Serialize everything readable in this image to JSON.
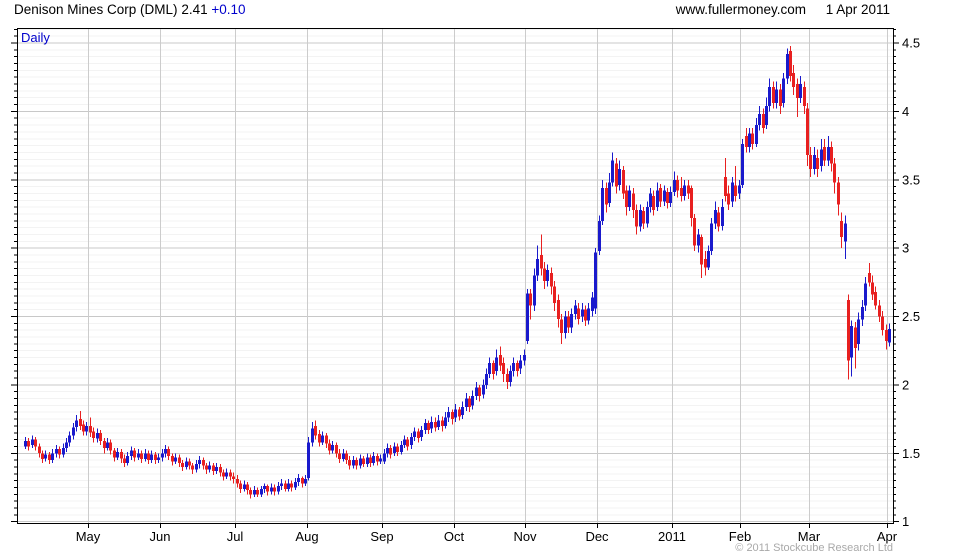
{
  "header": {
    "instrument": "Denison Mines Corp (DML)",
    "price": "2.41",
    "change": "+0.10",
    "website": "www.fullermoney.com",
    "date": "1 Apr 2011"
  },
  "chart": {
    "frequency_label": "Daily",
    "copyright": "© 2011 Stockcube Research Ltd"
  },
  "colors": {
    "up": "#1a1acc",
    "down": "#e82020",
    "grid_major": "#c8c8c8",
    "grid_minor": "#f3f3f3",
    "month_line": "#cccccc",
    "border": "#000000",
    "accent_blue": "#0000cc",
    "copyright_grey": "#a9a9a9"
  },
  "chart_data": {
    "type": "candlestick",
    "title": "Denison Mines Corp (DML)",
    "frequency": "Daily",
    "last_price": 2.41,
    "change": 0.1,
    "ylim": [
      0.99,
      4.61
    ],
    "y_ticks": [
      1,
      1.5,
      2,
      2.5,
      3,
      3.5,
      4,
      4.5
    ],
    "y_minor_step": 0.05,
    "x_months": [
      {
        "label": "May",
        "start": 19
      },
      {
        "label": "Jun",
        "start": 40
      },
      {
        "label": "Jul",
        "start": 62
      },
      {
        "label": "Aug",
        "start": 83
      },
      {
        "label": "Sep",
        "start": 105
      },
      {
        "label": "Oct",
        "start": 126
      },
      {
        "label": "Nov",
        "start": 147
      },
      {
        "label": "Dec",
        "start": 168
      },
      {
        "label": "2011",
        "start": 190
      },
      {
        "label": "Feb",
        "start": 210
      },
      {
        "label": "Mar",
        "start": 230
      },
      {
        "label": "Apr",
        "start": 253
      }
    ],
    "ohlc_format": [
      "open",
      "high",
      "low",
      "close"
    ],
    "ohlc": [
      [
        1.55,
        1.62,
        1.53,
        1.59
      ],
      [
        1.59,
        1.61,
        1.52,
        1.55
      ],
      [
        1.56,
        1.63,
        1.54,
        1.6
      ],
      [
        1.6,
        1.62,
        1.52,
        1.55
      ],
      [
        1.55,
        1.57,
        1.47,
        1.5
      ],
      [
        1.5,
        1.52,
        1.43,
        1.46
      ],
      [
        1.46,
        1.52,
        1.44,
        1.49
      ],
      [
        1.49,
        1.51,
        1.42,
        1.45
      ],
      [
        1.45,
        1.53,
        1.43,
        1.5
      ],
      [
        1.5,
        1.56,
        1.47,
        1.53
      ],
      [
        1.53,
        1.55,
        1.46,
        1.49
      ],
      [
        1.49,
        1.57,
        1.47,
        1.54
      ],
      [
        1.54,
        1.61,
        1.51,
        1.58
      ],
      [
        1.58,
        1.66,
        1.55,
        1.63
      ],
      [
        1.63,
        1.72,
        1.6,
        1.69
      ],
      [
        1.69,
        1.78,
        1.66,
        1.74
      ],
      [
        1.75,
        1.81,
        1.67,
        1.7
      ],
      [
        1.71,
        1.74,
        1.63,
        1.66
      ],
      [
        1.66,
        1.73,
        1.63,
        1.7
      ],
      [
        1.7,
        1.76,
        1.62,
        1.65
      ],
      [
        1.66,
        1.69,
        1.58,
        1.61
      ],
      [
        1.61,
        1.68,
        1.58,
        1.65
      ],
      [
        1.65,
        1.67,
        1.56,
        1.59
      ],
      [
        1.59,
        1.61,
        1.5,
        1.54
      ],
      [
        1.54,
        1.61,
        1.52,
        1.58
      ],
      [
        1.58,
        1.6,
        1.49,
        1.52
      ],
      [
        1.52,
        1.54,
        1.44,
        1.47
      ],
      [
        1.47,
        1.54,
        1.45,
        1.51
      ],
      [
        1.51,
        1.53,
        1.43,
        1.46
      ],
      [
        1.46,
        1.49,
        1.4,
        1.43
      ],
      [
        1.43,
        1.51,
        1.41,
        1.48
      ],
      [
        1.48,
        1.55,
        1.45,
        1.52
      ],
      [
        1.52,
        1.54,
        1.44,
        1.47
      ],
      [
        1.47,
        1.53,
        1.45,
        1.5
      ],
      [
        1.5,
        1.52,
        1.43,
        1.46
      ],
      [
        1.46,
        1.53,
        1.44,
        1.5
      ],
      [
        1.5,
        1.52,
        1.42,
        1.45
      ],
      [
        1.45,
        1.52,
        1.43,
        1.49
      ],
      [
        1.49,
        1.51,
        1.42,
        1.45
      ],
      [
        1.45,
        1.5,
        1.43,
        1.47
      ],
      [
        1.47,
        1.53,
        1.44,
        1.5
      ],
      [
        1.5,
        1.56,
        1.47,
        1.53
      ],
      [
        1.53,
        1.55,
        1.45,
        1.48
      ],
      [
        1.48,
        1.5,
        1.41,
        1.44
      ],
      [
        1.44,
        1.5,
        1.42,
        1.47
      ],
      [
        1.47,
        1.49,
        1.4,
        1.43
      ],
      [
        1.43,
        1.45,
        1.37,
        1.4
      ],
      [
        1.4,
        1.47,
        1.38,
        1.44
      ],
      [
        1.44,
        1.46,
        1.38,
        1.41
      ],
      [
        1.41,
        1.43,
        1.35,
        1.38
      ],
      [
        1.38,
        1.45,
        1.36,
        1.42
      ],
      [
        1.42,
        1.48,
        1.39,
        1.45
      ],
      [
        1.45,
        1.47,
        1.38,
        1.41
      ],
      [
        1.41,
        1.43,
        1.35,
        1.38
      ],
      [
        1.38,
        1.44,
        1.36,
        1.41
      ],
      [
        1.41,
        1.43,
        1.34,
        1.37
      ],
      [
        1.37,
        1.43,
        1.35,
        1.4
      ],
      [
        1.4,
        1.42,
        1.33,
        1.36
      ],
      [
        1.36,
        1.38,
        1.3,
        1.33
      ],
      [
        1.33,
        1.39,
        1.31,
        1.36
      ],
      [
        1.36,
        1.38,
        1.3,
        1.33
      ],
      [
        1.33,
        1.36,
        1.28,
        1.31
      ],
      [
        1.31,
        1.34,
        1.25,
        1.28
      ],
      [
        1.28,
        1.3,
        1.21,
        1.24
      ],
      [
        1.24,
        1.3,
        1.22,
        1.27
      ],
      [
        1.27,
        1.29,
        1.2,
        1.23
      ],
      [
        1.23,
        1.25,
        1.17,
        1.2
      ],
      [
        1.2,
        1.26,
        1.18,
        1.23
      ],
      [
        1.23,
        1.25,
        1.18,
        1.2
      ],
      [
        1.2,
        1.26,
        1.18,
        1.24
      ],
      [
        1.24,
        1.28,
        1.21,
        1.26
      ],
      [
        1.26,
        1.27,
        1.19,
        1.22
      ],
      [
        1.22,
        1.28,
        1.2,
        1.25
      ],
      [
        1.25,
        1.27,
        1.19,
        1.22
      ],
      [
        1.22,
        1.29,
        1.2,
        1.26
      ],
      [
        1.26,
        1.31,
        1.23,
        1.28
      ],
      [
        1.28,
        1.3,
        1.22,
        1.24
      ],
      [
        1.24,
        1.31,
        1.22,
        1.28
      ],
      [
        1.28,
        1.3,
        1.22,
        1.25
      ],
      [
        1.25,
        1.32,
        1.23,
        1.29
      ],
      [
        1.29,
        1.35,
        1.26,
        1.32
      ],
      [
        1.32,
        1.33,
        1.25,
        1.28
      ],
      [
        1.28,
        1.34,
        1.26,
        1.31
      ],
      [
        1.32,
        1.62,
        1.3,
        1.58
      ],
      [
        1.58,
        1.73,
        1.55,
        1.68
      ],
      [
        1.7,
        1.74,
        1.6,
        1.63
      ],
      [
        1.64,
        1.67,
        1.55,
        1.58
      ],
      [
        1.58,
        1.66,
        1.56,
        1.63
      ],
      [
        1.63,
        1.65,
        1.54,
        1.57
      ],
      [
        1.57,
        1.6,
        1.49,
        1.52
      ],
      [
        1.52,
        1.59,
        1.5,
        1.56
      ],
      [
        1.56,
        1.58,
        1.47,
        1.5
      ],
      [
        1.5,
        1.53,
        1.43,
        1.46
      ],
      [
        1.46,
        1.53,
        1.44,
        1.5
      ],
      [
        1.5,
        1.52,
        1.42,
        1.45
      ],
      [
        1.45,
        1.48,
        1.38,
        1.41
      ],
      [
        1.41,
        1.48,
        1.39,
        1.45
      ],
      [
        1.45,
        1.47,
        1.38,
        1.41
      ],
      [
        1.41,
        1.49,
        1.39,
        1.46
      ],
      [
        1.46,
        1.48,
        1.4,
        1.42
      ],
      [
        1.42,
        1.5,
        1.4,
        1.47
      ],
      [
        1.47,
        1.49,
        1.4,
        1.43
      ],
      [
        1.43,
        1.51,
        1.41,
        1.48
      ],
      [
        1.48,
        1.5,
        1.41,
        1.44
      ],
      [
        1.44,
        1.49,
        1.42,
        1.46
      ],
      [
        1.44,
        1.53,
        1.42,
        1.5
      ],
      [
        1.5,
        1.57,
        1.47,
        1.54
      ],
      [
        1.54,
        1.56,
        1.46,
        1.49
      ],
      [
        1.5,
        1.58,
        1.48,
        1.55
      ],
      [
        1.55,
        1.57,
        1.48,
        1.51
      ],
      [
        1.51,
        1.59,
        1.49,
        1.56
      ],
      [
        1.56,
        1.63,
        1.54,
        1.6
      ],
      [
        1.6,
        1.62,
        1.52,
        1.55
      ],
      [
        1.56,
        1.65,
        1.53,
        1.62
      ],
      [
        1.62,
        1.69,
        1.59,
        1.66
      ],
      [
        1.66,
        1.68,
        1.58,
        1.61
      ],
      [
        1.62,
        1.7,
        1.59,
        1.67
      ],
      [
        1.67,
        1.75,
        1.64,
        1.72
      ],
      [
        1.72,
        1.74,
        1.64,
        1.67
      ],
      [
        1.68,
        1.77,
        1.65,
        1.73
      ],
      [
        1.73,
        1.76,
        1.66,
        1.69
      ],
      [
        1.69,
        1.78,
        1.67,
        1.74
      ],
      [
        1.74,
        1.77,
        1.66,
        1.7
      ],
      [
        1.7,
        1.8,
        1.68,
        1.76
      ],
      [
        1.76,
        1.84,
        1.73,
        1.8
      ],
      [
        1.8,
        1.82,
        1.71,
        1.75
      ],
      [
        1.76,
        1.86,
        1.73,
        1.82
      ],
      [
        1.82,
        1.84,
        1.74,
        1.77
      ],
      [
        1.78,
        1.88,
        1.75,
        1.84
      ],
      [
        1.84,
        1.94,
        1.81,
        1.9
      ],
      [
        1.9,
        1.92,
        1.8,
        1.84
      ],
      [
        1.85,
        1.96,
        1.82,
        1.92
      ],
      [
        1.92,
        2.02,
        1.89,
        1.98
      ],
      [
        1.98,
        2.0,
        1.88,
        1.92
      ],
      [
        1.93,
        2.04,
        1.9,
        2.0
      ],
      [
        2.0,
        2.12,
        1.97,
        2.08
      ],
      [
        2.08,
        2.2,
        2.05,
        2.16
      ],
      [
        2.16,
        2.18,
        2.04,
        2.08
      ],
      [
        2.1,
        2.26,
        2.07,
        2.2
      ],
      [
        2.22,
        2.28,
        2.1,
        2.14
      ],
      [
        2.16,
        2.2,
        2.02,
        2.08
      ],
      [
        2.08,
        2.12,
        1.97,
        2.02
      ],
      [
        2.02,
        2.14,
        1.99,
        2.1
      ],
      [
        2.1,
        2.2,
        2.06,
        2.16
      ],
      [
        2.16,
        2.18,
        2.06,
        2.1
      ],
      [
        2.12,
        2.22,
        2.08,
        2.18
      ],
      [
        2.18,
        2.26,
        2.14,
        2.22
      ],
      [
        2.32,
        2.7,
        2.3,
        2.67
      ],
      [
        2.67,
        2.7,
        2.48,
        2.58
      ],
      [
        2.58,
        2.85,
        2.54,
        2.8
      ],
      [
        2.8,
        3.02,
        2.76,
        2.92
      ],
      [
        2.95,
        3.1,
        2.8,
        2.85
      ],
      [
        2.85,
        2.9,
        2.7,
        2.76
      ],
      [
        2.76,
        2.88,
        2.72,
        2.84
      ],
      [
        2.82,
        2.86,
        2.66,
        2.72
      ],
      [
        2.72,
        2.76,
        2.54,
        2.6
      ],
      [
        2.62,
        2.66,
        2.42,
        2.48
      ],
      [
        2.48,
        2.52,
        2.3,
        2.38
      ],
      [
        2.38,
        2.54,
        2.34,
        2.5
      ],
      [
        2.5,
        2.54,
        2.38,
        2.42
      ],
      [
        2.42,
        2.56,
        2.38,
        2.52
      ],
      [
        2.52,
        2.62,
        2.48,
        2.58
      ],
      [
        2.56,
        2.6,
        2.44,
        2.48
      ],
      [
        2.5,
        2.6,
        2.46,
        2.55
      ],
      [
        2.55,
        2.58,
        2.43,
        2.47
      ],
      [
        2.47,
        2.6,
        2.44,
        2.56
      ],
      [
        2.54,
        2.68,
        2.5,
        2.64
      ],
      [
        2.56,
        3.0,
        2.52,
        2.97
      ],
      [
        2.98,
        3.24,
        2.95,
        3.2
      ],
      [
        3.2,
        3.5,
        3.17,
        3.44
      ],
      [
        3.44,
        3.48,
        3.26,
        3.32
      ],
      [
        3.33,
        3.55,
        3.3,
        3.48
      ],
      [
        3.48,
        3.7,
        3.45,
        3.64
      ],
      [
        3.62,
        3.66,
        3.4,
        3.45
      ],
      [
        3.46,
        3.64,
        3.42,
        3.58
      ],
      [
        3.57,
        3.6,
        3.36,
        3.4
      ],
      [
        3.42,
        3.46,
        3.24,
        3.3
      ],
      [
        3.3,
        3.46,
        3.27,
        3.42
      ],
      [
        3.4,
        3.44,
        3.22,
        3.28
      ],
      [
        3.28,
        3.32,
        3.1,
        3.16
      ],
      [
        3.16,
        3.32,
        3.12,
        3.28
      ],
      [
        3.27,
        3.3,
        3.14,
        3.18
      ],
      [
        3.18,
        3.34,
        3.15,
        3.3
      ],
      [
        3.3,
        3.44,
        3.26,
        3.4
      ],
      [
        3.38,
        3.42,
        3.24,
        3.28
      ],
      [
        3.3,
        3.48,
        3.27,
        3.42
      ],
      [
        3.44,
        3.47,
        3.3,
        3.34
      ],
      [
        3.34,
        3.46,
        3.31,
        3.42
      ],
      [
        3.41,
        3.44,
        3.29,
        3.33
      ],
      [
        3.33,
        3.45,
        3.3,
        3.41
      ],
      [
        3.41,
        3.56,
        3.38,
        3.5
      ],
      [
        3.5,
        3.53,
        3.37,
        3.42
      ],
      [
        3.44,
        3.52,
        3.34,
        3.38
      ],
      [
        3.38,
        3.5,
        3.35,
        3.46
      ],
      [
        3.46,
        3.5,
        3.36,
        3.4
      ],
      [
        3.44,
        3.46,
        3.16,
        3.22
      ],
      [
        3.22,
        3.25,
        2.98,
        3.02
      ],
      [
        3.02,
        3.14,
        2.97,
        3.1
      ],
      [
        3.08,
        3.1,
        2.78,
        2.88
      ],
      [
        2.92,
        2.98,
        2.8,
        2.86
      ],
      [
        2.86,
        3.02,
        2.84,
        2.98
      ],
      [
        2.98,
        3.22,
        2.95,
        3.18
      ],
      [
        3.18,
        3.34,
        3.14,
        3.28
      ],
      [
        3.26,
        3.3,
        3.12,
        3.16
      ],
      [
        3.16,
        3.36,
        3.13,
        3.3
      ],
      [
        3.52,
        3.66,
        3.34,
        3.38
      ],
      [
        3.4,
        3.46,
        3.28,
        3.32
      ],
      [
        3.34,
        3.52,
        3.3,
        3.48
      ],
      [
        3.46,
        3.6,
        3.34,
        3.38
      ],
      [
        3.4,
        3.5,
        3.36,
        3.46
      ],
      [
        3.46,
        3.8,
        3.44,
        3.76
      ],
      [
        3.82,
        3.88,
        3.7,
        3.74
      ],
      [
        3.74,
        3.88,
        3.7,
        3.84
      ],
      [
        3.84,
        3.88,
        3.72,
        3.76
      ],
      [
        3.76,
        3.95,
        3.74,
        3.9
      ],
      [
        3.9,
        4.04,
        3.86,
        3.98
      ],
      [
        3.98,
        4.02,
        3.84,
        3.88
      ],
      [
        3.9,
        4.1,
        3.87,
        4.04
      ],
      [
        4.04,
        4.24,
        4.0,
        4.18
      ],
      [
        4.18,
        4.22,
        4.02,
        4.06
      ],
      [
        4.06,
        4.22,
        4.02,
        4.16
      ],
      [
        4.16,
        4.2,
        3.98,
        4.04
      ],
      [
        4.06,
        4.28,
        4.03,
        4.24
      ],
      [
        4.24,
        4.46,
        4.2,
        4.42
      ],
      [
        4.44,
        4.48,
        4.22,
        4.26
      ],
      [
        4.28,
        4.34,
        4.12,
        4.18
      ],
      [
        4.2,
        4.24,
        3.96,
        4.1
      ],
      [
        4.1,
        4.26,
        4.06,
        4.2
      ],
      [
        4.18,
        4.22,
        3.98,
        4.04
      ],
      [
        4.02,
        4.06,
        3.6,
        3.68
      ],
      [
        3.68,
        3.74,
        3.52,
        3.58
      ],
      [
        3.58,
        3.74,
        3.54,
        3.68
      ],
      [
        3.66,
        3.72,
        3.52,
        3.58
      ],
      [
        3.6,
        3.8,
        3.56,
        3.72
      ],
      [
        3.74,
        3.8,
        3.6,
        3.64
      ],
      [
        3.64,
        3.82,
        3.6,
        3.74
      ],
      [
        3.74,
        3.78,
        3.56,
        3.62
      ],
      [
        3.62,
        3.66,
        3.4,
        3.48
      ],
      [
        3.48,
        3.52,
        3.24,
        3.32
      ],
      [
        3.2,
        3.26,
        3.0,
        3.08
      ],
      [
        3.05,
        3.24,
        2.92,
        3.18
      ],
      [
        2.62,
        2.66,
        2.04,
        2.18
      ],
      [
        2.2,
        2.47,
        2.06,
        2.43
      ],
      [
        2.42,
        2.46,
        2.12,
        2.27
      ],
      [
        2.3,
        2.53,
        2.25,
        2.48
      ],
      [
        2.48,
        2.62,
        2.43,
        2.57
      ],
      [
        2.58,
        2.79,
        2.54,
        2.74
      ],
      [
        2.82,
        2.89,
        2.72,
        2.75
      ],
      [
        2.75,
        2.8,
        2.62,
        2.66
      ],
      [
        2.68,
        2.72,
        2.55,
        2.58
      ],
      [
        2.58,
        2.62,
        2.46,
        2.5
      ],
      [
        2.5,
        2.54,
        2.36,
        2.4
      ],
      [
        2.4,
        2.44,
        2.26,
        2.32
      ],
      [
        2.31,
        2.45,
        2.28,
        2.41
      ]
    ]
  }
}
